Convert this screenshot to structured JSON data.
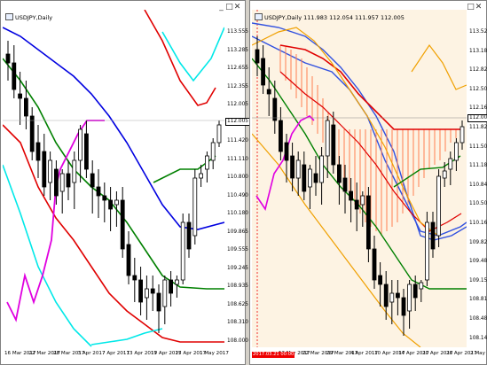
{
  "left_window": {
    "title": "USDJPY,Daily",
    "current_price": "112.005",
    "y_ticks": [
      "113.555",
      "113.285",
      "112.655",
      "112.355",
      "112.005",
      "111.730",
      "111.420",
      "111.110",
      "110.800",
      "110.490",
      "110.180",
      "109.865",
      "109.555",
      "109.245",
      "108.935",
      "108.625",
      "108.310",
      "108.000"
    ],
    "x_ticks": [
      "16 Mar 2017",
      "22 Mar 2017",
      "28 Mar 2017",
      "3 Apr 2017",
      "7 Apr 2017",
      "13 Apr 2017",
      "19 Apr 2017",
      "25 Apr 2017",
      "1 May 2017"
    ]
  },
  "right_window": {
    "title": "USDJPY,Daily",
    "ohlc": "111.983 112.054 111.957 112.005",
    "current_price": "112.005",
    "y_ticks": [
      "113.525",
      "113.180",
      "112.825",
      "112.500",
      "112.165",
      "111.820",
      "111.500",
      "111.180",
      "110.840",
      "110.505",
      "110.160",
      "109.825",
      "109.485",
      "109.155",
      "108.815",
      "108.480",
      "108.145"
    ],
    "x_ticks": [
      "16 Mar 2017",
      "22 Mar 2017",
      "29 Mar 2017",
      "4 Apr 2017",
      "10 Apr 2017",
      "14 Apr 2017",
      "20 Apr 2017",
      "26 Apr 2017",
      "2 May 2017"
    ],
    "date_tag": "2017.03.21 00:00"
  },
  "window_controls": {
    "minimize": "_",
    "maximize": "□",
    "close": "✕"
  },
  "colors": {
    "red": "#e00000",
    "blue": "#0000e0",
    "green": "#008000",
    "cyan": "#00e8e8",
    "magenta": "#e000e0",
    "orange": "#f0a000",
    "cloud_bg": "#fdf3e3",
    "ichimoku_blue": "#3050e0",
    "cloud_hatch": "#ff7f50"
  }
}
